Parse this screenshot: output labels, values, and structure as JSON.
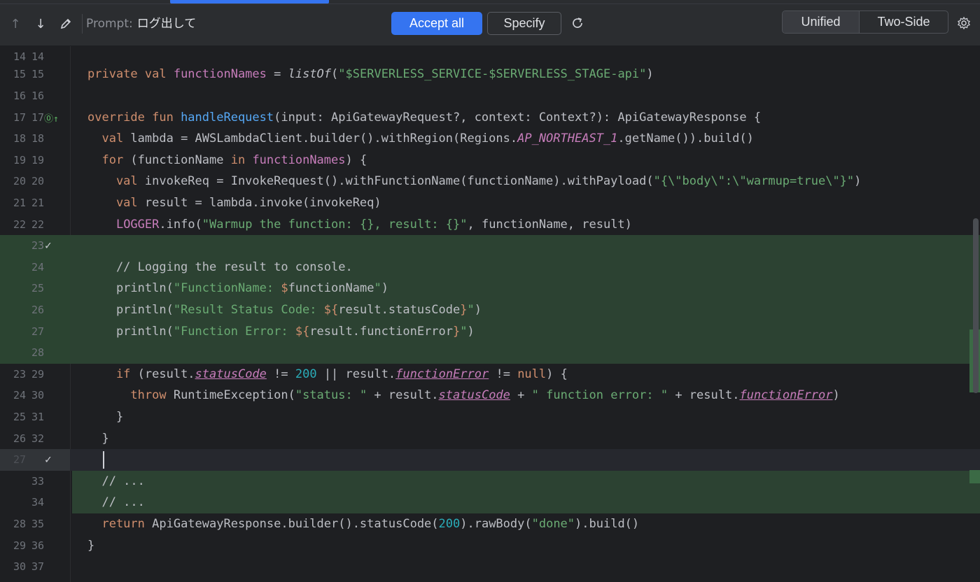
{
  "toolbar": {
    "prompt_label": "Prompt:",
    "prompt_text": "ログ出して",
    "accept_all": "Accept all",
    "specify": "Specify",
    "view_unified": "Unified",
    "view_two_side": "Two-Side"
  },
  "lines": [
    {
      "n1": "14",
      "n2": "14"
    },
    {
      "n1": "15",
      "n2": "15"
    },
    {
      "n1": "16",
      "n2": "16"
    },
    {
      "n1": "17",
      "n2": "17"
    },
    {
      "n1": "18",
      "n2": "18"
    },
    {
      "n1": "19",
      "n2": "19"
    },
    {
      "n1": "20",
      "n2": "20"
    },
    {
      "n1": "21",
      "n2": "21"
    },
    {
      "n1": "22",
      "n2": "22"
    },
    {
      "n1": "",
      "n2": "23"
    },
    {
      "n1": "",
      "n2": "24"
    },
    {
      "n1": "",
      "n2": "25"
    },
    {
      "n1": "",
      "n2": "26"
    },
    {
      "n1": "",
      "n2": "27"
    },
    {
      "n1": "",
      "n2": "28"
    },
    {
      "n1": "23",
      "n2": "29"
    },
    {
      "n1": "24",
      "n2": "30"
    },
    {
      "n1": "25",
      "n2": "31"
    },
    {
      "n1": "26",
      "n2": "32"
    },
    {
      "n1": "27",
      "n2": ""
    },
    {
      "n1": "",
      "n2": "33"
    },
    {
      "n1": "",
      "n2": "34"
    },
    {
      "n1": "28",
      "n2": "35"
    },
    {
      "n1": "29",
      "n2": "36"
    },
    {
      "n1": "30",
      "n2": "37"
    }
  ],
  "code": {
    "l15": {
      "a": "private val ",
      "b": "functionNames",
      "c": " = ",
      "d": "listOf",
      "e": "(",
      "f": "\"$SERVERLESS_SERVICE-$SERVERLESS_STAGE-api\"",
      "g": ")"
    },
    "l17": {
      "a": "override fun ",
      "b": "handleRequest",
      "c": "(input: ApiGatewayRequest?, context: Context?): ApiGatewayResponse {"
    },
    "l18": {
      "a": "  val ",
      "b": "lambda = AWSLambdaClient.builder().withRegion(Regions.",
      "c": "AP_NORTHEAST_1",
      "d": ".getName()).build()"
    },
    "l19": {
      "a": "  for ",
      "b": "(functionName ",
      "c": "in ",
      "d": "functionNames",
      "e": ") {"
    },
    "l20": {
      "a": "    val ",
      "b": "invokeReq = InvokeRequest().withFunctionName(functionName).withPayload(",
      "c": "\"{\\\"body\\\":\\\"warmup=true\\\"}\"",
      "d": ")"
    },
    "l21": {
      "a": "    val ",
      "b": "result = lambda.invoke(invokeReq)"
    },
    "l22": {
      "a": "    ",
      "b": "LOGGER",
      "c": ".info(",
      "d": "\"Warmup the function: {}, result: {}\"",
      "e": ", functionName, result)"
    },
    "l24": {
      "a": "    // Logging the result to console."
    },
    "l25": {
      "a": "    println(",
      "b": "\"FunctionName: ",
      "c": "$",
      "d": "functionName",
      "e": "\"",
      "f": ")"
    },
    "l26": {
      "a": "    println(",
      "b": "\"Result Status Code: ",
      "c": "${",
      "d": "result.statusCode",
      "e": "}",
      "f": "\"",
      "g": ")"
    },
    "l27": {
      "a": "    println(",
      "b": "\"Function Error: ",
      "c": "${",
      "d": "result.functionError",
      "e": "}",
      "f": "\"",
      "g": ")"
    },
    "l29": {
      "a": "    if ",
      "b": "(result.",
      "c": "statusCode",
      "d": " != ",
      "e": "200",
      "f": " || result.",
      "g": "functionError",
      "h": " != ",
      "i": "null",
      "j": ") {"
    },
    "l30": {
      "a": "      throw ",
      "b": "RuntimeException(",
      "c": "\"status: \"",
      "d": " + result.",
      "e": "statusCode",
      "f": " + ",
      "g": "\" function error: \"",
      "h": " + result.",
      "i": "functionError",
      "j": ")"
    },
    "l31": {
      "a": "    }"
    },
    "l32": {
      "a": "  }"
    },
    "l33": {
      "a": "  // ..."
    },
    "l34": {
      "a": "  // ..."
    },
    "l35": {
      "a": "  return ",
      "b": "ApiGatewayResponse.builder().statusCode(",
      "c": "200",
      "d": ").rawBody(",
      "e": "\"done\"",
      "f": ").build()"
    },
    "l36": {
      "a": "}"
    }
  }
}
